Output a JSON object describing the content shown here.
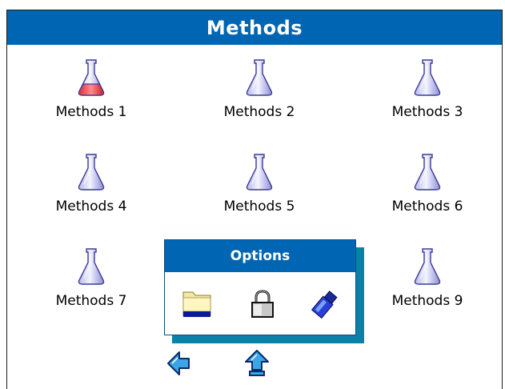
{
  "window": {
    "title": "Methods"
  },
  "methods": [
    {
      "label": "Methods 1",
      "icon": "flask-filled-icon",
      "active": true
    },
    {
      "label": "Methods 2",
      "icon": "flask-icon"
    },
    {
      "label": "Methods 3",
      "icon": "flask-icon"
    },
    {
      "label": "Methods 4",
      "icon": "flask-icon"
    },
    {
      "label": "Methods 5",
      "icon": "flask-icon"
    },
    {
      "label": "Methods 6",
      "icon": "flask-icon"
    },
    {
      "label": "Methods 7",
      "icon": "flask-icon"
    },
    {
      "label": "Methods 9",
      "icon": "flask-icon"
    }
  ],
  "options": {
    "title": "Options",
    "items": [
      "folder-icon",
      "lock-icon",
      "usb-drive-icon"
    ]
  },
  "nav": [
    "back-arrow-icon",
    "up-arrow-icon"
  ],
  "colors": {
    "accent": "#0066b3",
    "shadow": "#0a82a8",
    "active_liquid": "#e8464a"
  }
}
